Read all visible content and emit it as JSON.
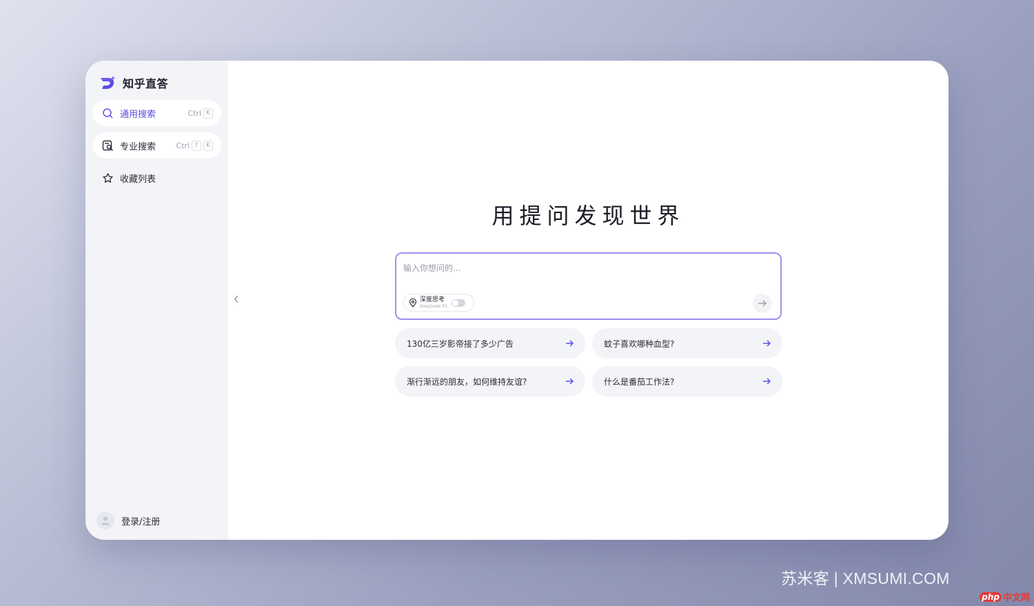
{
  "app": {
    "name": "知乎直答"
  },
  "sidebar": {
    "items": [
      {
        "label": "通用搜索",
        "icon": "search-icon",
        "shortcut": [
          "Ctrl",
          "K"
        ],
        "active": true
      },
      {
        "label": "专业搜索",
        "icon": "pro-search-icon",
        "shortcut": [
          "Ctrl",
          "⇧",
          "K"
        ],
        "active": false
      },
      {
        "label": "收藏列表",
        "icon": "star-icon",
        "active": false
      }
    ],
    "login_label": "登录/注册"
  },
  "main": {
    "headline": "用提问发现世界",
    "search": {
      "placeholder": "输入你想问的...",
      "deep_think_label": "深度思考",
      "deep_think_model": "DeepSeek R1",
      "deep_think_on": false
    },
    "suggestions": [
      "130亿三岁影帝接了多少广告",
      "蚊子喜欢哪种血型?",
      "渐行渐远的朋友，如何维持友谊?",
      "什么是番茄工作法?"
    ]
  },
  "watermark": {
    "text": "苏米客 | XMSUMI.COM",
    "badge_php": "php",
    "badge_cn": "中文网"
  },
  "colors": {
    "accent": "#5b4de8",
    "border_gradient": "#a58cf0",
    "sidebar_bg": "#f3f4f8"
  }
}
